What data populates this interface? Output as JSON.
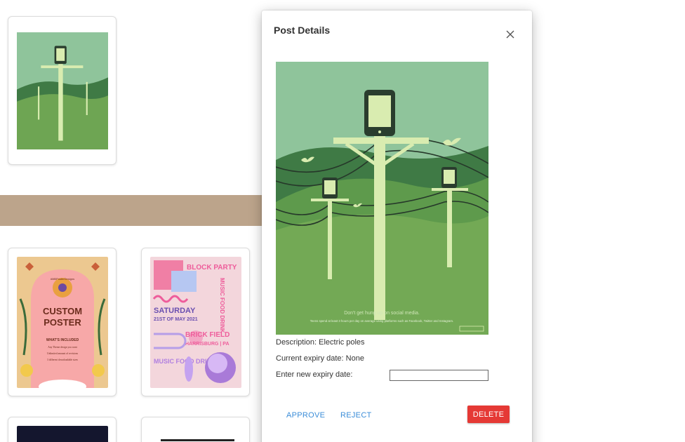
{
  "dialog": {
    "title": "Post Details",
    "description_label": "Description: Electric poles",
    "expiry_label": "Current expiry date: None",
    "new_expiry_label": "Enter new expiry date:",
    "new_expiry_value": "",
    "approve_label": "APPROVE",
    "reject_label": "REJECT",
    "delete_label": "DELETE"
  },
  "poster": {
    "caption": "Don't get hung up on social media.",
    "subcaption": "Teens spend at least 3 hours per day on average using platforms such as Facebook, Twitter and Instagram."
  },
  "custom_poster": {
    "brand": "#MBPosterDesigns",
    "title_line1": "CUSTOM",
    "title_line2": "POSTER",
    "subtitle": "WHAT'S INCLUDED",
    "item1": "Any Theme design you want",
    "item2": "Unlimited amount of revisions",
    "item3": "3 different downloadable sizes"
  },
  "party_poster": {
    "headline": "BLOCK PARTY",
    "side_text": "MUSIC FOOD DRINK",
    "day": "SATURDAY",
    "date": "21ST OF MAY 2021",
    "venue": "BRICK FIELD",
    "city": "HARRISBURG | PA",
    "footer": "MUSIC FOOD DRINK"
  },
  "colors": {
    "band": "#bca48b",
    "delete": "#e53935",
    "link": "#3b8dd8"
  }
}
